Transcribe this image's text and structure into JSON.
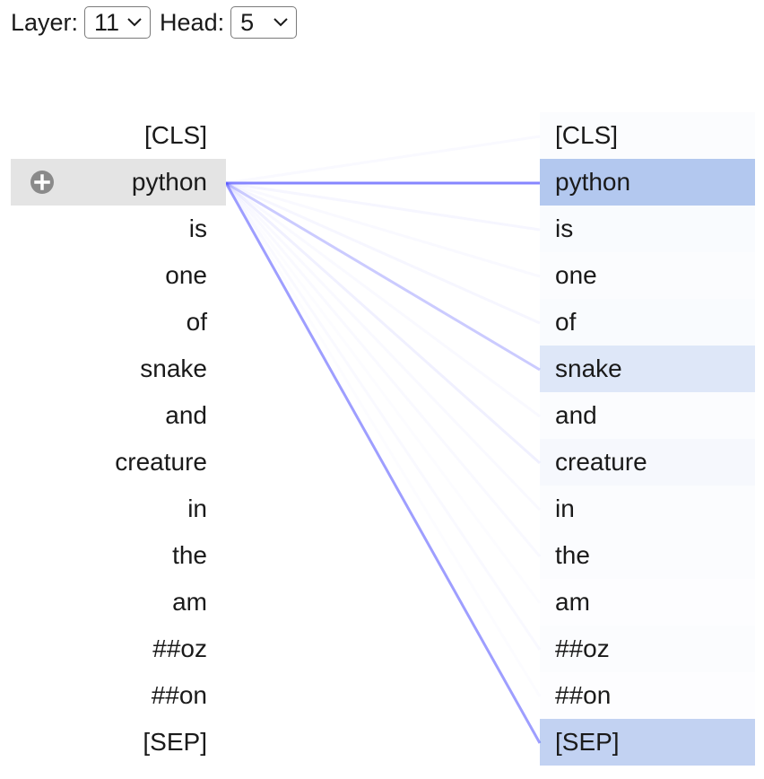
{
  "controls": {
    "layer_label": "Layer:",
    "layer_value": "11",
    "head_label": "Head:",
    "head_value": "5"
  },
  "tokens": [
    "[CLS]",
    "python",
    "is",
    "one",
    "of",
    "snake",
    "and",
    "creature",
    "in",
    "the",
    "am",
    "##oz",
    "##on",
    "[SEP]"
  ],
  "selected_index": 1,
  "attention": [
    0.02,
    0.4,
    0.03,
    0.02,
    0.03,
    0.17,
    0.02,
    0.05,
    0.02,
    0.02,
    0.01,
    0.02,
    0.01,
    0.32
  ],
  "colors": {
    "line": "#4d4dff",
    "highlight": "#4a7bd9",
    "selected_left_bg": "#e4e4e4",
    "expand_icon": "#8a8a8a"
  },
  "icons": {
    "expand": "plus-circle-icon",
    "dropdown": "chevron-down-icon"
  }
}
